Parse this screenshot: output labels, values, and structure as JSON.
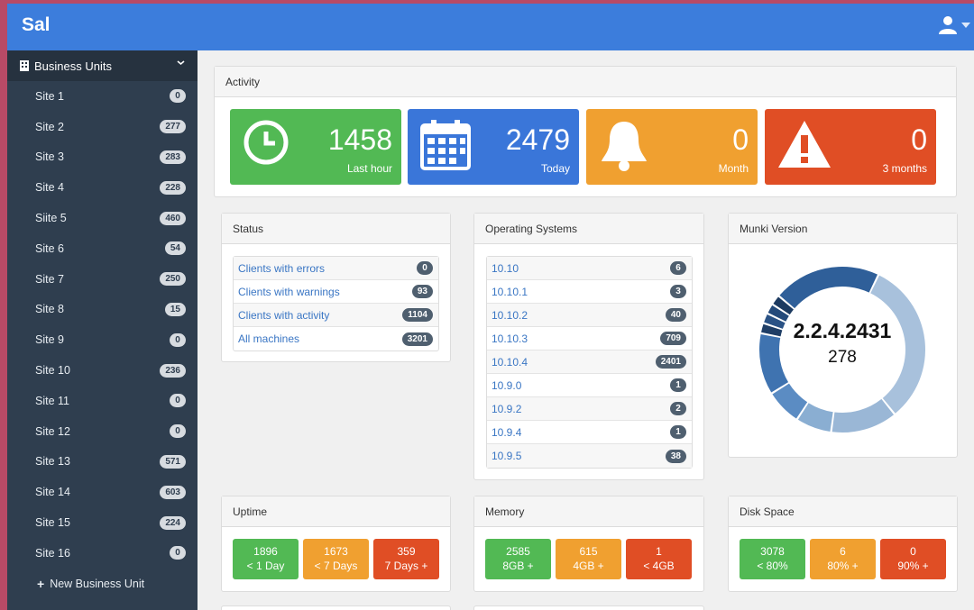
{
  "app": {
    "brand": "Sal"
  },
  "sidebar": {
    "header": "Business Units",
    "items": [
      {
        "label": "Site 1",
        "count": "0"
      },
      {
        "label": "Site 2",
        "count": "277"
      },
      {
        "label": "Site 3",
        "count": "283"
      },
      {
        "label": "Site 4",
        "count": "228"
      },
      {
        "label": "Siite 5",
        "count": "460"
      },
      {
        "label": "Site 6",
        "count": "54"
      },
      {
        "label": "Site 7",
        "count": "250"
      },
      {
        "label": "Site 8",
        "count": "15"
      },
      {
        "label": "Site 9",
        "count": "0"
      },
      {
        "label": "Site 10",
        "count": "236"
      },
      {
        "label": "Site 11",
        "count": "0"
      },
      {
        "label": "Site 12",
        "count": "0"
      },
      {
        "label": "Site 13",
        "count": "571"
      },
      {
        "label": "Site 14",
        "count": "603"
      },
      {
        "label": "Site 15",
        "count": "224"
      },
      {
        "label": "Site 16",
        "count": "0"
      }
    ],
    "new_label": "New Business Unit"
  },
  "activity": {
    "title": "Activity",
    "tiles": [
      {
        "value": "1458",
        "label": "Last hour",
        "color": "#52b954",
        "icon": "clock-icon"
      },
      {
        "value": "2479",
        "label": "Today",
        "color": "#3a76d9",
        "icon": "calendar-icon"
      },
      {
        "value": "0",
        "label": "Month",
        "color": "#f0a030",
        "icon": "bell-icon"
      },
      {
        "value": "0",
        "label": "3 months",
        "color": "#e04e25",
        "icon": "warning-icon"
      }
    ]
  },
  "status": {
    "title": "Status",
    "rows": [
      {
        "label": "Clients with errors",
        "count": "0"
      },
      {
        "label": "Clients with warnings",
        "count": "93"
      },
      {
        "label": "Clients with activity",
        "count": "1104"
      },
      {
        "label": "All machines",
        "count": "3201"
      }
    ]
  },
  "os": {
    "title": "Operating Systems",
    "rows": [
      {
        "label": "10.10",
        "count": "6"
      },
      {
        "label": "10.10.1",
        "count": "3"
      },
      {
        "label": "10.10.2",
        "count": "40"
      },
      {
        "label": "10.10.3",
        "count": "709"
      },
      {
        "label": "10.10.4",
        "count": "2401"
      },
      {
        "label": "10.9.0",
        "count": "1"
      },
      {
        "label": "10.9.2",
        "count": "2"
      },
      {
        "label": "10.9.4",
        "count": "1"
      },
      {
        "label": "10.9.5",
        "count": "38"
      }
    ]
  },
  "munki": {
    "title": "Munki Version",
    "center_version": "2.2.4.2431",
    "center_count": "278",
    "segment_colors": [
      "#a8c1dc",
      "#9ab7d6",
      "#8aaed2",
      "#5b8cc3",
      "#3f73b0",
      "#1f3e66",
      "#2a5285",
      "#244a7a",
      "#1c3a60",
      "#2f5f99"
    ],
    "segments": [
      0.32,
      0.13,
      0.07,
      0.07,
      0.12,
      0.02,
      0.02,
      0.02,
      0.02,
      0.21
    ]
  },
  "uptime": {
    "title": "Uptime",
    "cells": [
      {
        "value": "1896",
        "label": "< 1 Day"
      },
      {
        "value": "1673",
        "label": "< 7 Days"
      },
      {
        "value": "359",
        "label": "7 Days +"
      }
    ]
  },
  "memory": {
    "title": "Memory",
    "cells": [
      {
        "value": "2585",
        "label": "8GB +"
      },
      {
        "value": "615",
        "label": "4GB +"
      },
      {
        "value": "1",
        "label": "< 4GB"
      }
    ]
  },
  "disk": {
    "title": "Disk Space",
    "cells": [
      {
        "value": "3078",
        "label": "< 80%"
      },
      {
        "value": "6",
        "label": "80% +"
      },
      {
        "value": "0",
        "label": "90% +"
      }
    ]
  }
}
